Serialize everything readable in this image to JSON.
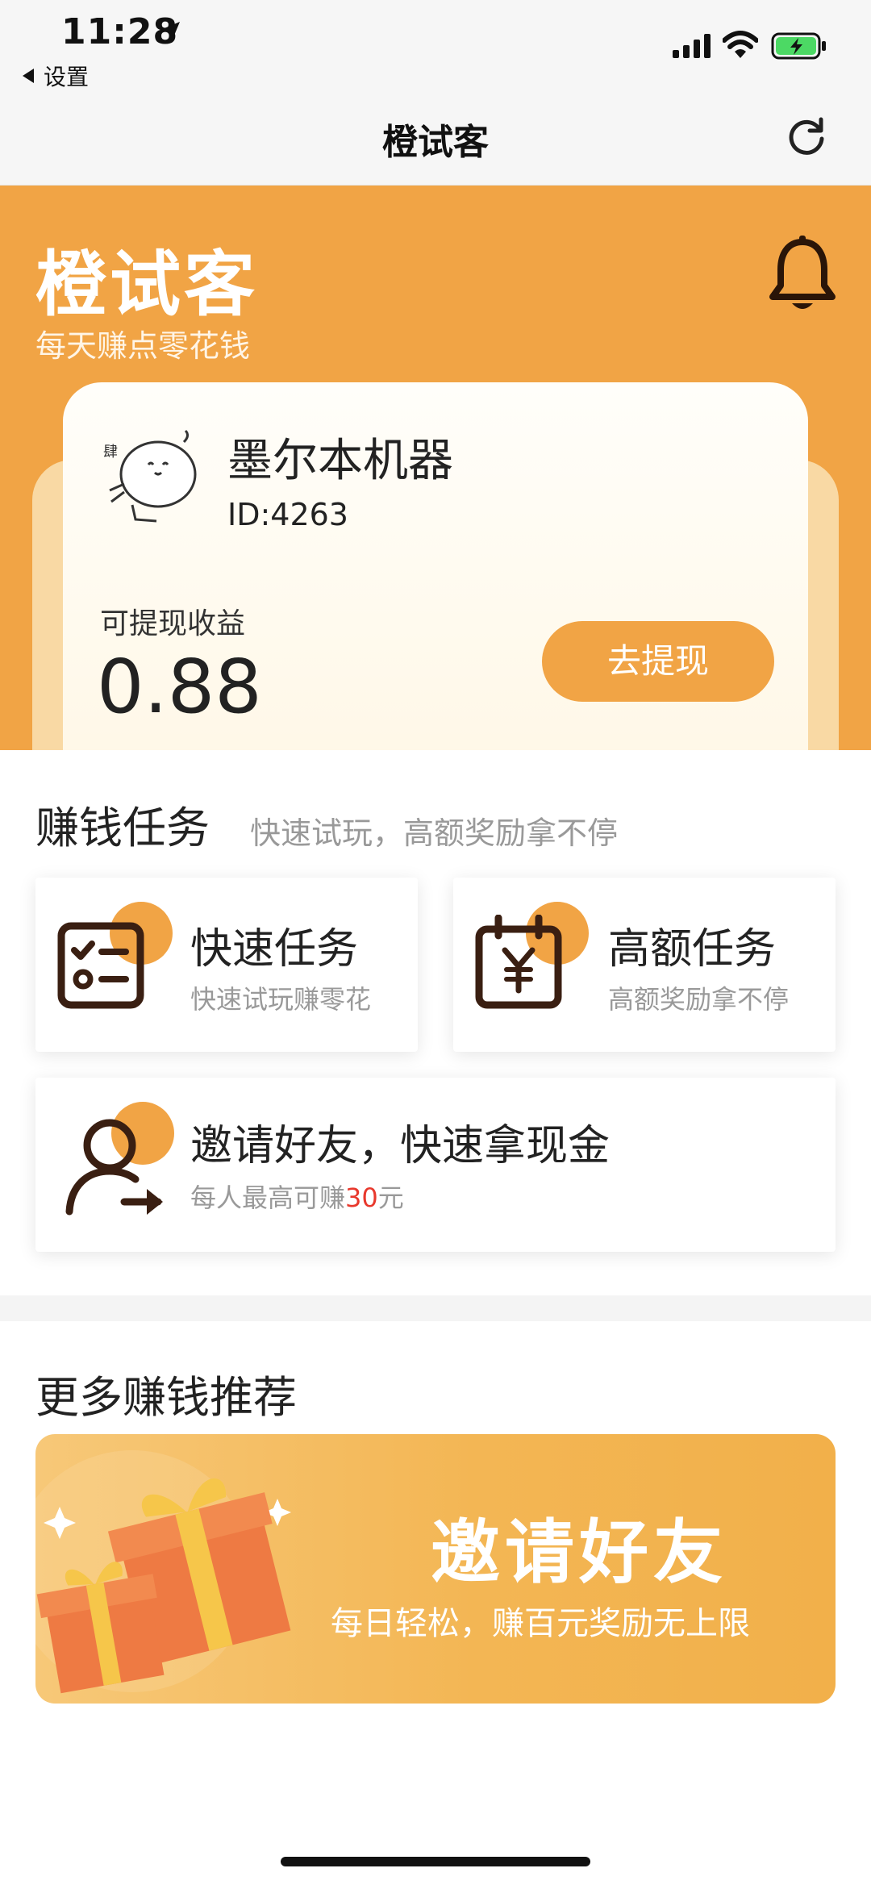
{
  "status_bar": {
    "time": "11:28",
    "back_app": "设置"
  },
  "nav": {
    "title": "橙试客"
  },
  "hero": {
    "title": "橙试客",
    "subtitle": "每天赚点零花钱",
    "user": {
      "name": "墨尔本机器",
      "id": "ID:4263"
    },
    "earnings_label": "可提现收益",
    "earnings_value": "0.88",
    "withdraw_label": "去提现"
  },
  "tasks_section": {
    "title": "赚钱任务",
    "subtitle": "快速试玩，高额奖励拿不停",
    "items": [
      {
        "title": "快速任务",
        "subtitle": "快速试玩赚零花",
        "icon": "checklist-icon"
      },
      {
        "title": "高额任务",
        "subtitle": "高额奖励拿不停",
        "icon": "calendar-yen-icon"
      }
    ],
    "invite": {
      "title": "邀请好友，快速拿现金",
      "subtitle_prefix": "每人最高可赚",
      "subtitle_amount": "30",
      "subtitle_suffix": "元",
      "icon": "add-user-icon"
    }
  },
  "more_section": {
    "title": "更多赚钱推荐",
    "banner": {
      "title": "邀请好友",
      "subtitle": "每日轻松，赚百元奖励无上限",
      "icon": "gift-icon"
    }
  },
  "colors": {
    "accent": "#f1a445",
    "dark_icon": "#3a1f12",
    "highlight_red": "#e8382c"
  }
}
